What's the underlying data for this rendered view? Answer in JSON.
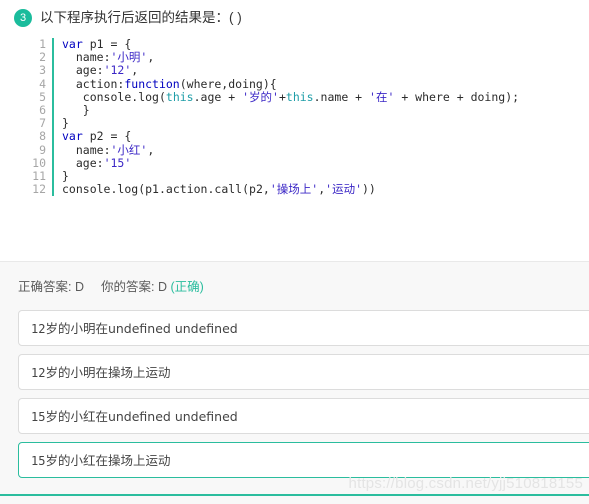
{
  "question": {
    "number": "3",
    "text": "以下程序执行后返回的结果是：(  )"
  },
  "code": {
    "language": "javascript",
    "line_numbers": [
      "1",
      "2",
      "3",
      "4",
      "5",
      "6",
      "7",
      "8",
      "9",
      "10",
      "11",
      "12"
    ],
    "lines": [
      "var p1 = {",
      "  name:'小明',",
      "  age:'12',",
      "  action:function(where,doing){",
      "   console.log(this.age + '岁的'+this.name + '在' + where + doing);",
      "   }",
      "}",
      "var p2 = {",
      "  name:'小红',",
      "  age:'15'",
      "}",
      "console.log(p1.action.call(p2,'操场上','运动'))"
    ]
  },
  "answer": {
    "correct_label": "正确答案:",
    "correct_value": "D",
    "your_label": "你的答案:",
    "your_value": "D",
    "result_text": "(正确)",
    "accent_color": "#2bbd9e"
  },
  "options": [
    {
      "id": "A",
      "text": "12岁的小明在undefined undefined",
      "selected": false
    },
    {
      "id": "B",
      "text": "12岁的小明在操场上运动",
      "selected": false
    },
    {
      "id": "C",
      "text": "15岁的小红在undefined undefined",
      "selected": false
    },
    {
      "id": "D",
      "text": "15岁的小红在操场上运动",
      "selected": true
    }
  ],
  "watermark": {
    "text": "https://blog.csdn.net/yjj510818155"
  }
}
